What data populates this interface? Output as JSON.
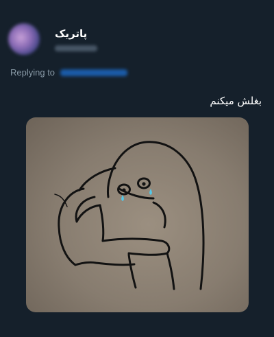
{
  "tweet": {
    "author": {
      "display_name": "پاتریک"
    },
    "replying_to_label": "Replying to",
    "text": "بغلش میکنم"
  }
}
